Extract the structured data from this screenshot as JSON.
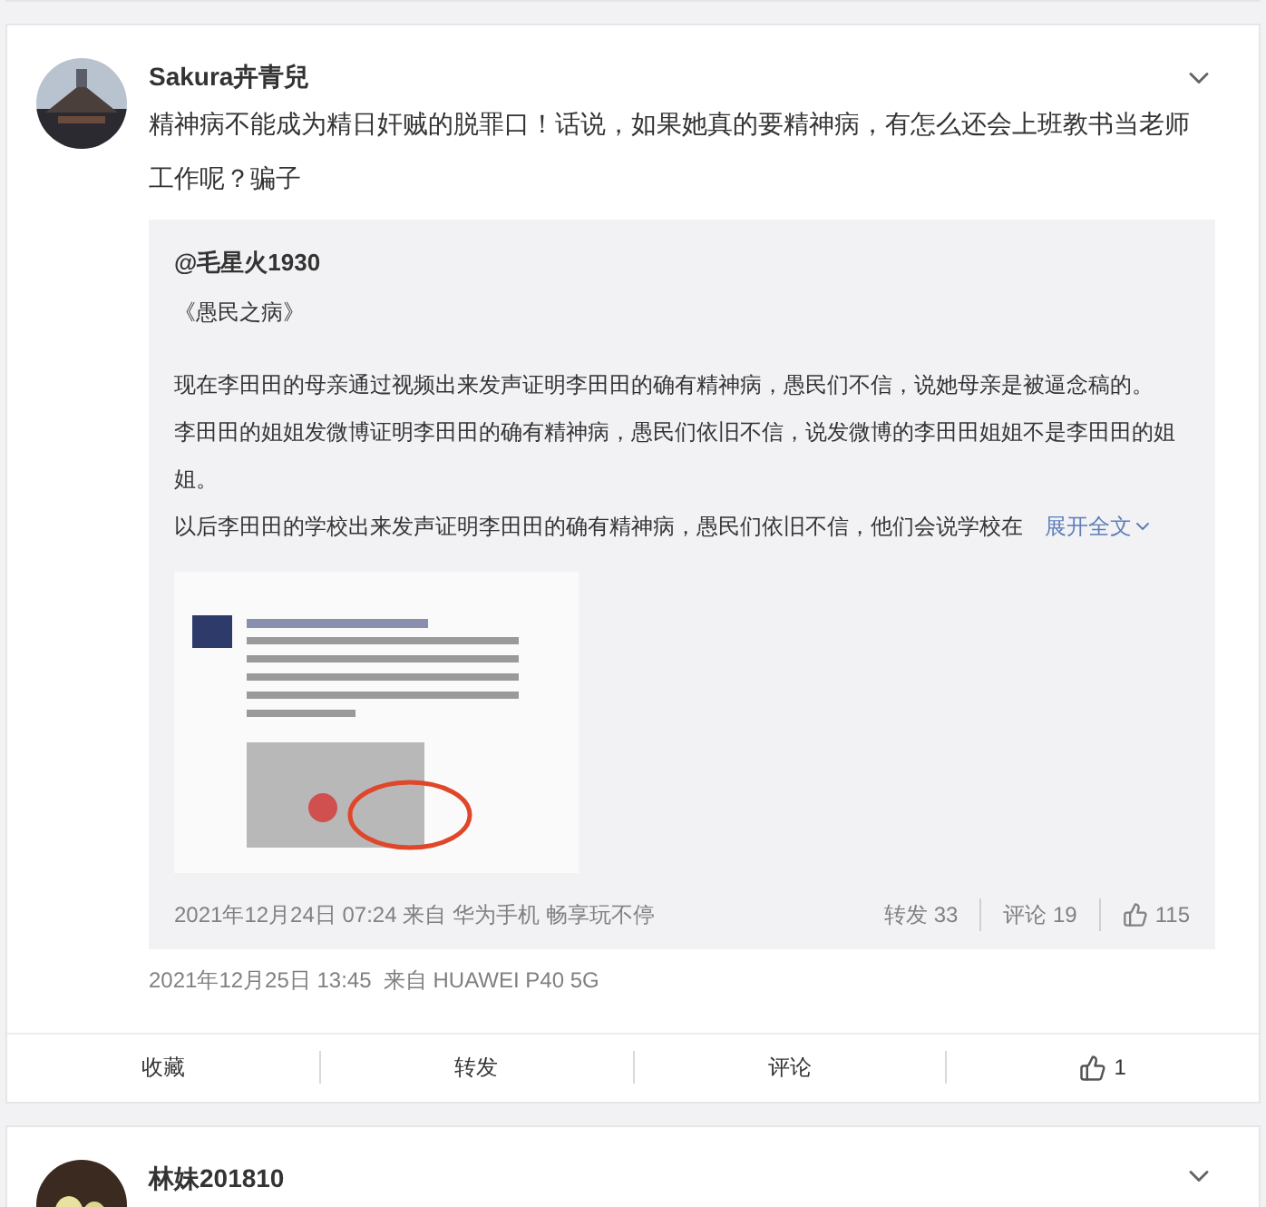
{
  "post": {
    "author": "Sakura卉青兒",
    "text": "精神病不能成为精日奸贼的脱罪口！话说，如果她真的要精神病，有怎么还会上班教书当老师工作呢？骗子",
    "quote": {
      "author": "@毛星火1930",
      "title": "《愚民之病》",
      "paragraphs": [
        "现在李田田的母亲通过视频出来发声证明李田田的确有精神病，愚民们不信，说她母亲是被逼念稿的。",
        "李田田的姐姐发微博证明李田田的确有精神病，愚民们依旧不信，说发微博的李田田姐姐不是李田田的姐姐。",
        "以后李田田的学校出来发声证明李田田的确有精神病，愚民们依旧不信，他们会说学校在"
      ],
      "expand": "展开全文",
      "image": {
        "kind": "picture"
      },
      "time": "2021年12月24日 07:24 来自 华为手机 畅享玩不停",
      "reposts": "转发 33",
      "comments": "评论 19",
      "likes": "115"
    },
    "time": "2021年12月25日 13:45  来自 HUAWEI P40 5G",
    "actions": [
      {
        "kind": "text",
        "label": "收藏"
      },
      {
        "kind": "text",
        "label": "转发"
      },
      {
        "kind": "text",
        "label": "评论"
      },
      {
        "kind": "like",
        "label": "1"
      }
    ]
  },
  "next_post": {
    "author": "林妹201810"
  }
}
